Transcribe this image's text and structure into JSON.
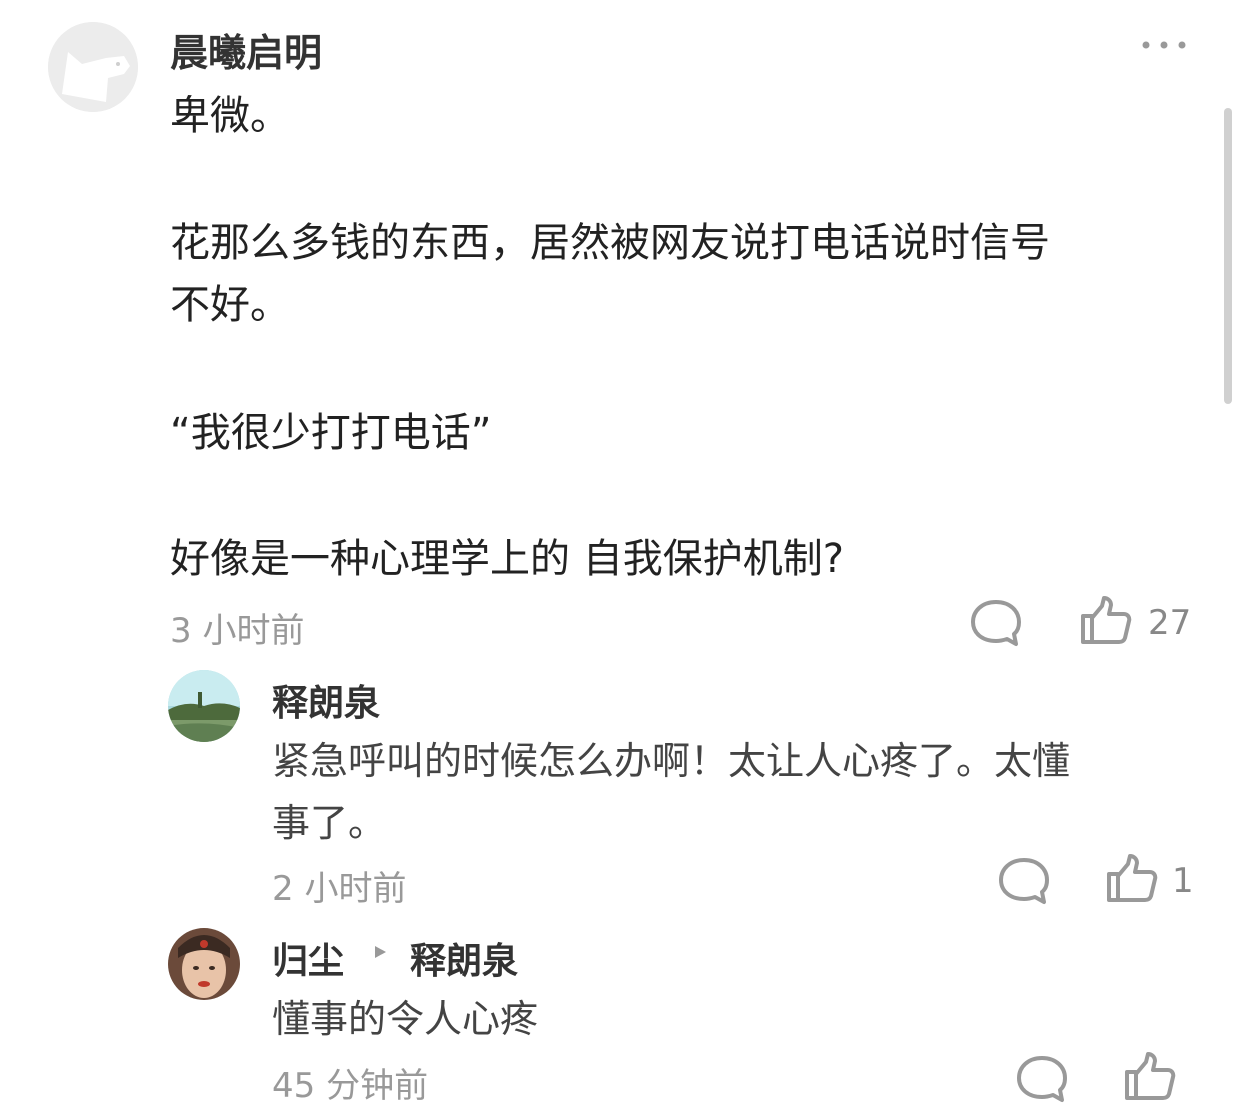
{
  "comment": {
    "author": "晨曦启明",
    "lines": [
      "卑微。",
      "花那么多钱的东西，居然被网友说打电话说时信号",
      "不好。",
      "“我很少打打电话”",
      "好像是一种心理学上的 自我保护机制?"
    ],
    "time": "3 小时前",
    "likes": "27",
    "more_icon": "more-icon"
  },
  "replies": [
    {
      "author": "释朗泉",
      "lines": [
        "紧急呼叫的时候怎么办啊！太让人心疼了。太懂",
        "事了。"
      ],
      "time": "2 小时前",
      "likes": "1"
    },
    {
      "author": "归尘",
      "reply_to": "释朗泉",
      "lines": [
        "懂事的令人心疼"
      ],
      "time": "45 分钟前",
      "likes": ""
    }
  ],
  "colors": {
    "text": "#222222",
    "meta": "#999999",
    "icon": "#888888"
  }
}
